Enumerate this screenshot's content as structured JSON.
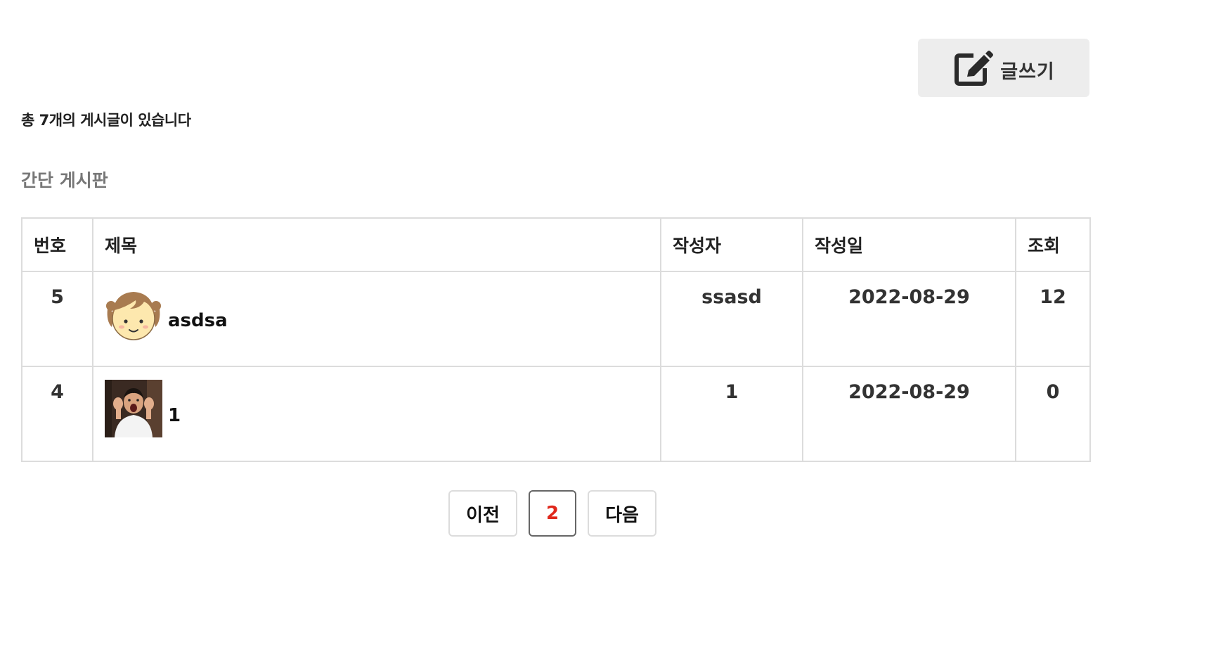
{
  "toolbar": {
    "write_label": "글쓰기",
    "write_icon": "edit-icon"
  },
  "summary": {
    "total_text": "총 7개의 게시글이 있습니다"
  },
  "board": {
    "title": "간단 게시판",
    "columns": {
      "num": "번호",
      "title": "제목",
      "author": "작성자",
      "date": "작성일",
      "views": "조회"
    },
    "rows": [
      {
        "num": "5",
        "title": "asdsa",
        "thumb": "girl-cartoon-thumbnail",
        "author": "ssasd",
        "date": "2022-08-29",
        "views": "12"
      },
      {
        "num": "4",
        "title": "1",
        "thumb": "person-photo-thumbnail",
        "author": "1",
        "date": "2022-08-29",
        "views": "0"
      }
    ]
  },
  "pagination": {
    "prev_label": "이전",
    "current_page": "2",
    "next_label": "다음",
    "current_color": "#e0281c"
  }
}
